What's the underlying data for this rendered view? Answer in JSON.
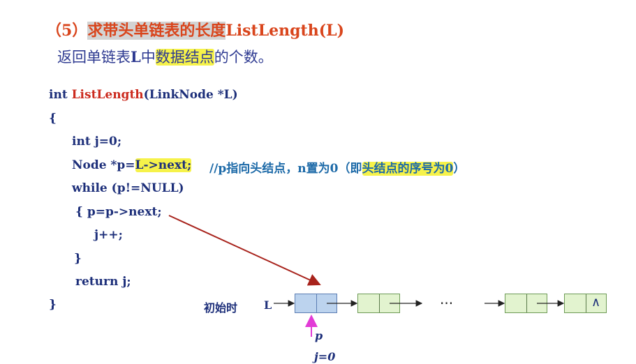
{
  "title": {
    "prefix": "（5）",
    "highlighted": "求带头单链表的长度",
    "suffix": "ListLength(L)"
  },
  "subtitle": {
    "part1": "返回单链表",
    "bold_l": "L",
    "part2": "中",
    "highlighted": "数据结点",
    "part3": "的个数。"
  },
  "code": {
    "line1_type": "int ",
    "line1_fn": "ListLength",
    "line1_params": "(LinkNode *L)",
    "line2": "{",
    "line3": "int j=0;",
    "line4_a": "Node *p=",
    "line4_hl": "L->next;",
    "line4_comment_a": "//p指向头结点，n置为0（即",
    "line4_comment_hl": "头结点的序号为0",
    "line4_comment_b": "）",
    "line5": "while (p!=NULL)",
    "line6": "{   p=p->next;",
    "line7": "j++;",
    "line8": "}",
    "line9": "return j;",
    "line10": "}"
  },
  "diagram": {
    "initial_label": "初始时",
    "list_label": "L",
    "ellipsis": "···",
    "nil_symbol": "∧",
    "pointer_label": "p",
    "counter_label": "j=0"
  },
  "colors": {
    "title": "#d9451c",
    "code": "#1d2f7a",
    "function_name": "#cc2b1f",
    "comment": "#1d6aa8",
    "highlight": "#f6f24a",
    "red_arrow": "#a8231c",
    "pointer_arrow": "#e23bd6"
  }
}
